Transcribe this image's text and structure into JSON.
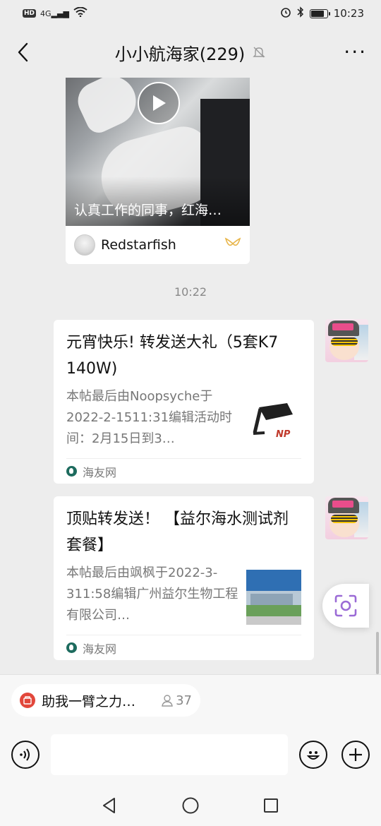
{
  "status_bar": {
    "hd_badge": "HD",
    "signal": "4G",
    "time": "10:23",
    "battery_level": 0.85
  },
  "header": {
    "title": "小小航海家(229)",
    "more_label": "···"
  },
  "messages": {
    "video": {
      "caption": "认真工作的同事，红海…",
      "source_name": "Redstarfish"
    },
    "timestamp": "10:22",
    "link1": {
      "title": "元宵快乐! 转发送大礼（5套K7  140W)",
      "desc": "本帖最后由Noopsyche于2022-2-1511:31编辑活动时间：2月15日到3…",
      "source": "海友网",
      "thumb_label": "NP"
    },
    "link2": {
      "title": "顶贴转发送！ 【益尔海水测试剂套餐】",
      "desc": "本帖最后由飒枫于2022-3-311:58编辑广州益尔生物工程有限公司…",
      "source": "海友网"
    }
  },
  "pinned_bar": {
    "text": "助我一臂之力…",
    "count": "37"
  },
  "input": {
    "placeholder": ""
  },
  "colors": {
    "background": "#ededed",
    "accent_purple": "#9b6bd6",
    "pill_red": "#e2473b",
    "channels_gold": "#e8b64c"
  }
}
